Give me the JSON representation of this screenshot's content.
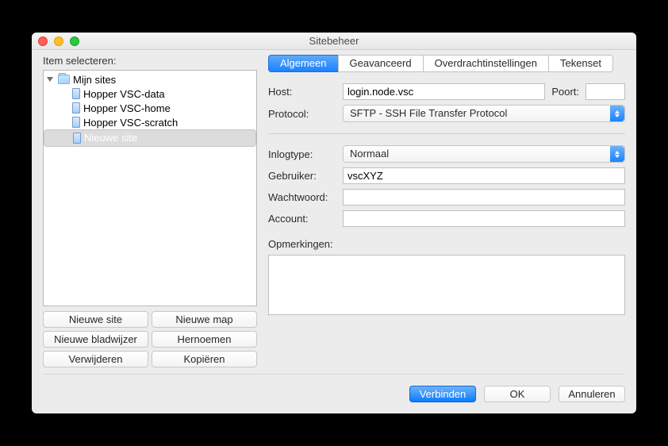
{
  "window": {
    "title": "Sitebeheer"
  },
  "left": {
    "select_label": "Item selecteren:",
    "root": "Mijn sites",
    "sites": [
      "Hopper VSC-data",
      "Hopper VSC-home",
      "Hopper VSC-scratch",
      "Nieuwe site"
    ],
    "buttons": {
      "new_site": "Nieuwe site",
      "new_folder": "Nieuwe map",
      "new_bookmark": "Nieuwe bladwijzer",
      "rename": "Hernoemen",
      "delete": "Verwijderen",
      "copy": "Kopiëren"
    }
  },
  "tabs": {
    "general": "Algemeen",
    "advanced": "Geavanceerd",
    "transfer": "Overdrachtinstellingen",
    "charset": "Tekenset"
  },
  "form": {
    "host_label": "Host:",
    "host_value": "login.node.vsc",
    "port_label": "Poort:",
    "port_value": "",
    "protocol_label": "Protocol:",
    "protocol_value": "SFTP - SSH File Transfer Protocol",
    "logontype_label": "Inlogtype:",
    "logontype_value": "Normaal",
    "user_label": "Gebruiker:",
    "user_value": "vscXYZ",
    "password_label": "Wachtwoord:",
    "password_value": "",
    "account_label": "Account:",
    "account_value": "",
    "comments_label": "Opmerkingen:",
    "comments_value": ""
  },
  "footer": {
    "connect": "Verbinden",
    "ok": "OK",
    "cancel": "Annuleren"
  }
}
